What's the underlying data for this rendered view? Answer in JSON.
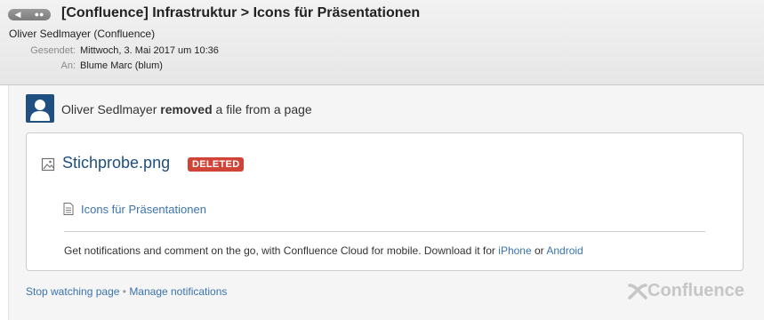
{
  "email": {
    "subject": "[Confluence] Infrastruktur > Icons für Präsentationen",
    "from": "Oliver Sedlmayer (Confluence)",
    "sent_label": "Gesendet:",
    "sent_value": "Mittwoch, 3. Mai 2017 um 10:36",
    "to_label": "An:",
    "to_value": "Blume Marc (blum)"
  },
  "nav": {
    "back_icon": "back-arrow-icon",
    "reply_icon": "speech-bubbles-icon"
  },
  "notification": {
    "actor": "Oliver Sedlmayer",
    "action": "removed",
    "rest": "a file from a page"
  },
  "file": {
    "name": "Stichprobe.png",
    "status": "DELETED",
    "status_color": "#d04437"
  },
  "page": {
    "title": "Icons für Präsentationen"
  },
  "mobile": {
    "text": "Get notifications and comment on the go, with Confluence Cloud for mobile. Download it for",
    "iphone": "iPhone",
    "or": "or",
    "android": "Android"
  },
  "footer": {
    "stop_watching": "Stop watching page",
    "separator": "•",
    "manage": "Manage notifications",
    "brand": "Confluence"
  },
  "colors": {
    "link": "#3b73af",
    "title_link": "#205081",
    "avatar_bg": "#205081"
  }
}
